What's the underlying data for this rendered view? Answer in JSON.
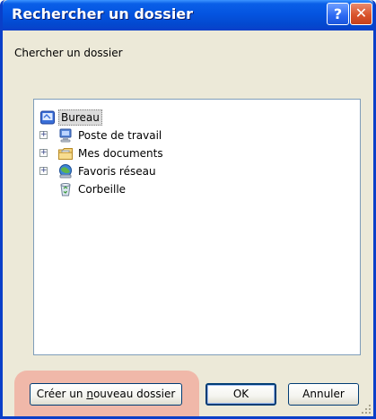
{
  "window": {
    "title": "Rechercher un dossier",
    "help_label": "?",
    "close_label": "✕"
  },
  "prompt": "Chercher un dossier",
  "tree": {
    "root": {
      "label": "Bureau",
      "icon": "desktop-icon",
      "selected": true
    },
    "children": [
      {
        "label": "Poste de travail",
        "icon": "computer-icon",
        "expandable": true
      },
      {
        "label": "Mes documents",
        "icon": "folder-documents-icon",
        "expandable": true
      },
      {
        "label": "Favoris réseau",
        "icon": "network-places-icon",
        "expandable": true
      },
      {
        "label": "Corbeille",
        "icon": "recycle-bin-icon",
        "expandable": false
      }
    ],
    "expander_symbol": "+"
  },
  "buttons": {
    "new_folder_pre": "Créer un ",
    "new_folder_mnemonic": "n",
    "new_folder_post": "ouveau dossier",
    "ok": "OK",
    "cancel": "Annuler"
  },
  "colors": {
    "title_bar": "#0454e0",
    "dialog_bg": "#ece9d8",
    "highlight": "#f0b8a9",
    "close_button": "#d9542c"
  }
}
